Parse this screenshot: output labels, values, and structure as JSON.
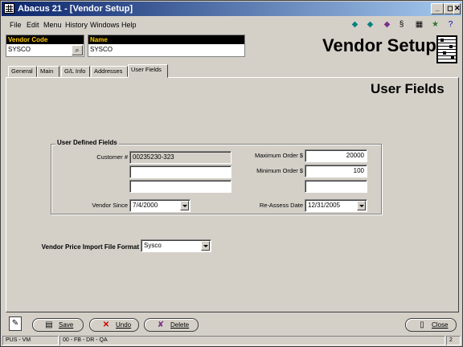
{
  "window": {
    "title": "Abacus 21 - [Vendor Setup]"
  },
  "menu": {
    "items": [
      "File",
      "Edit",
      "Menu",
      "History",
      "Windows",
      "Help"
    ]
  },
  "header": {
    "vendor_code_label": "Vendor Code",
    "vendor_code": "SYSCO",
    "name_label": "Name",
    "name": "SYSCO",
    "page_title": "Vendor Setup"
  },
  "tabs": [
    "General",
    "Main",
    "G/L Info",
    "Addresses",
    "User Fields"
  ],
  "active_tab": "User Fields",
  "section_title": "User Fields",
  "group": {
    "legend": "User Defined Fields",
    "customer_label": "Customer #",
    "customer_value": "00235230-323",
    "vendor_since_label": "Vendor Since",
    "vendor_since": "7/4/2000",
    "max_order_label": "Maximum Order $",
    "max_order": "20000",
    "min_order_label": "Minimum Order $",
    "min_order": "100",
    "reassess_label": "Re-Assess Date",
    "reassess_date": "12/31/2005"
  },
  "import": {
    "label": "Vendor Price Import File Format",
    "value": "Sysco"
  },
  "buttons": {
    "save": "Save",
    "undo": "Undo",
    "delete": "Delete",
    "close": "Close"
  },
  "status": {
    "left": "PUS - VM",
    "middle": "00 - FB - DR - QA",
    "right": "2"
  }
}
